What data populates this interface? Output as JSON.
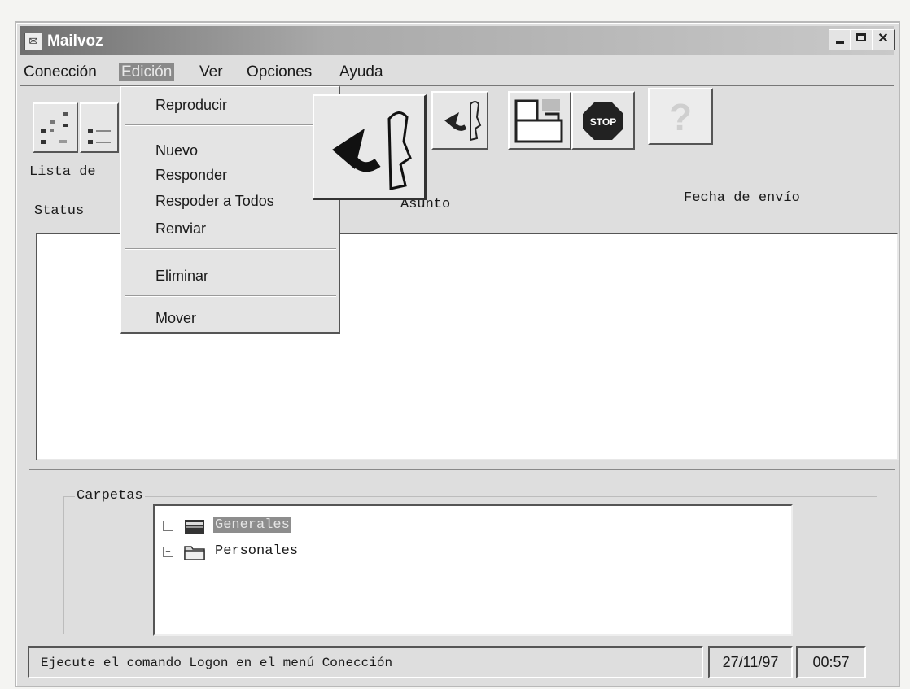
{
  "window": {
    "title": "Mailvoz",
    "icon": "app-icon"
  },
  "menubar": {
    "items": [
      {
        "label": "Coneccion",
        "full": "Conección",
        "mnemonic": "C"
      },
      {
        "label": "Edición",
        "mnemonic": "E",
        "active": true
      },
      {
        "label": "Ver",
        "mnemonic": "V"
      },
      {
        "label": "Opciones",
        "mnemonic": "O"
      },
      {
        "label": "Ayuda",
        "mnemonic": "A"
      }
    ]
  },
  "edit_menu": {
    "items": [
      {
        "label": "Reproducir",
        "mnemonic": "R"
      },
      {
        "label": "Nuevo",
        "mnemonic": "N"
      },
      {
        "label": "Responder",
        "mnemonic": "R"
      },
      {
        "label": "Respoder a Todos",
        "mnemonic": "T"
      },
      {
        "label": "Renviar",
        "mnemonic": "n"
      },
      {
        "label": "Eliminar",
        "mnemonic": "E"
      },
      {
        "label": "Mover",
        "mnemonic": "M"
      }
    ]
  },
  "toolbar": {
    "buttons": [
      "list-view-icon",
      "details-view-icon",
      "reply-voice-icon",
      "folder-move-icon",
      "stop-icon",
      "help-icon"
    ],
    "stop_label": "STOP",
    "help_label": "?"
  },
  "list": {
    "label": "Lista de",
    "columns": [
      "Status",
      "Asunto",
      "Fecha de envío"
    ]
  },
  "folders": {
    "label": "Carpetas",
    "items": [
      {
        "label": "Generales",
        "selected": true
      },
      {
        "label": "Personales",
        "selected": false
      }
    ]
  },
  "statusbar": {
    "message": "Ejecute el comando Logon en el menú Conección",
    "date": "27/11/97",
    "time": "00:57"
  }
}
